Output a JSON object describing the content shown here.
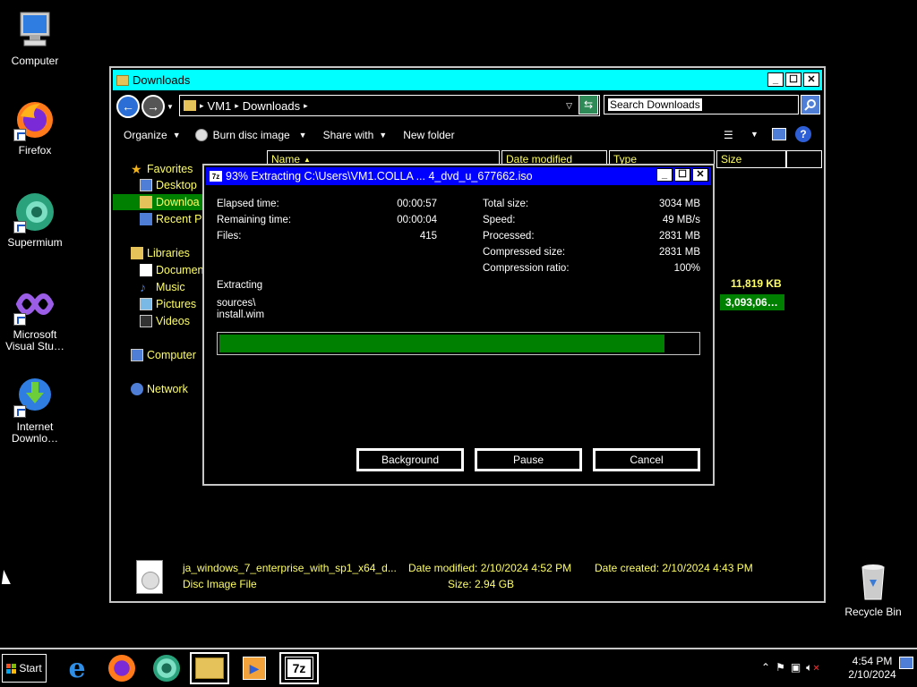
{
  "desktop": {
    "icons": [
      {
        "label": "Computer"
      },
      {
        "label": "Firefox"
      },
      {
        "label": "Supermium"
      },
      {
        "label": "Microsoft Visual Stu…"
      },
      {
        "label": "Internet Downlo…"
      },
      {
        "label": "Recycle Bin"
      }
    ]
  },
  "explorer": {
    "title": "Downloads",
    "address": [
      "VM1",
      "Downloads"
    ],
    "search_placeholder": "Search Downloads",
    "toolbar": {
      "organize": "Organize",
      "burn": "Burn disc image",
      "share": "Share with",
      "new_folder": "New folder"
    },
    "nav": {
      "favorites": "Favorites",
      "desktop": "Desktop",
      "downloads": "Downloa",
      "recent": "Recent P",
      "libraries": "Libraries",
      "documents": "Documen",
      "music": "Music",
      "pictures": "Pictures",
      "videos": "Videos",
      "computer": "Computer",
      "network": "Network"
    },
    "columns": {
      "name": "Name",
      "date": "Date modified",
      "type": "Type",
      "size": "Size"
    },
    "sizes": [
      "11,819 KB",
      "3,093,06…"
    ],
    "details": {
      "filename": "ja_windows_7_enterprise_with_sp1_x64_d...",
      "filetype": "Disc Image File",
      "date_modified": "Date modified: 2/10/2024 4:52 PM",
      "size": "Size: 2.94 GB",
      "date_created": "Date created: 2/10/2024 4:43 PM"
    }
  },
  "dialog": {
    "title": "93% Extracting C:\\Users\\VM1.COLLA ... 4_dvd_u_677662.iso",
    "left": [
      {
        "label": "Elapsed time:",
        "value": "00:00:57"
      },
      {
        "label": "Remaining time:",
        "value": "00:00:04"
      },
      {
        "label": "Files:",
        "value": "415"
      }
    ],
    "right": [
      {
        "label": "Total size:",
        "value": "3034 MB"
      },
      {
        "label": "Speed:",
        "value": "49 MB/s"
      },
      {
        "label": "Processed:",
        "value": "2831 MB"
      },
      {
        "label": "Compressed size:",
        "value": "2831 MB"
      },
      {
        "label": "Compression ratio:",
        "value": "100%"
      }
    ],
    "status": "Extracting",
    "path1": "sources\\",
    "path2": "install.wim",
    "progress": 0.93,
    "buttons": {
      "background": "Background",
      "pause": "Pause",
      "cancel": "Cancel"
    }
  },
  "taskbar": {
    "start": "Start",
    "time": "4:54 PM",
    "date": "2/10/2024"
  }
}
